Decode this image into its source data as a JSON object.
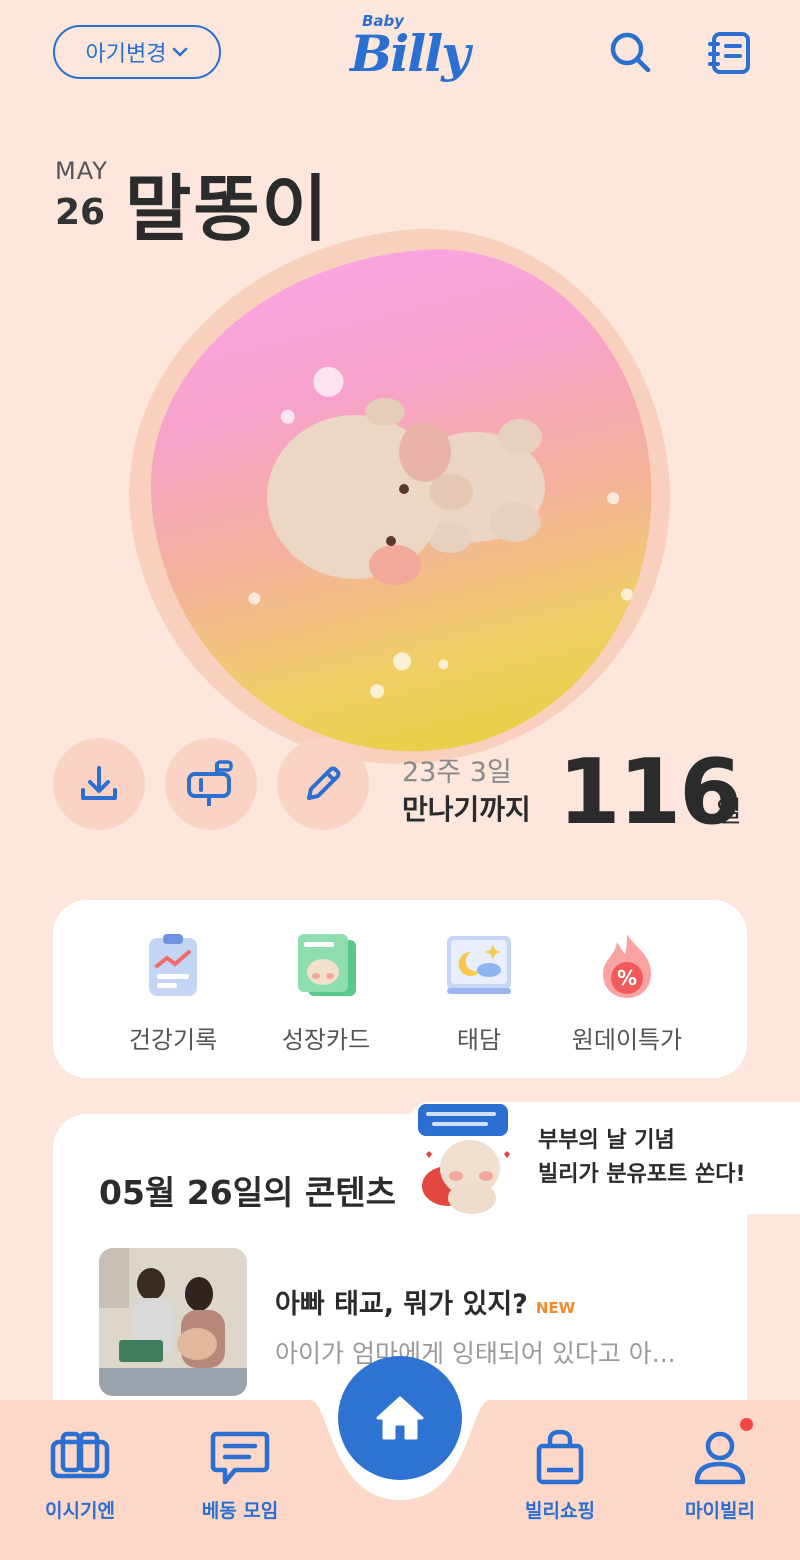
{
  "header": {
    "baby_change_label": "아기변경",
    "logo_small": "Baby",
    "logo_text": "Billy"
  },
  "date": {
    "month": "MAY",
    "day": "26"
  },
  "baby_name": "말똥이",
  "pregnancy": {
    "weeks": "23주 3일",
    "until_label": "만나기까지",
    "days_left": "116",
    "day_unit": "일"
  },
  "quick_menu": [
    {
      "label": "건강기록",
      "icon": "health-record-icon"
    },
    {
      "label": "성장카드",
      "icon": "growth-card-icon"
    },
    {
      "label": "태담",
      "icon": "night-story-book-icon"
    },
    {
      "label": "원데이특가",
      "icon": "fire-discount-icon"
    }
  ],
  "content": {
    "title": "05월 26일의 콘텐츠",
    "articles": [
      {
        "title": "아빠 태교, 뭐가 있지?",
        "badge": "NEW",
        "desc": "아이가 엄마에게 잉태되어 있다고 아..."
      }
    ]
  },
  "promo": {
    "line1": "부부의 날 기념",
    "line2": "빌리가 분유포트 쏜다!"
  },
  "nav": [
    {
      "label": "이시기엔",
      "icon": "book-open-icon"
    },
    {
      "label": "베동 모임",
      "icon": "chat-icon"
    },
    {
      "label": "빌리쇼핑",
      "icon": "shopping-bag-icon"
    },
    {
      "label": "마이빌리",
      "icon": "user-icon"
    }
  ],
  "colors": {
    "accent": "#2b6fd1",
    "background": "#fde6dc",
    "badge": "#f08a2a",
    "notification": "#f0473e"
  }
}
